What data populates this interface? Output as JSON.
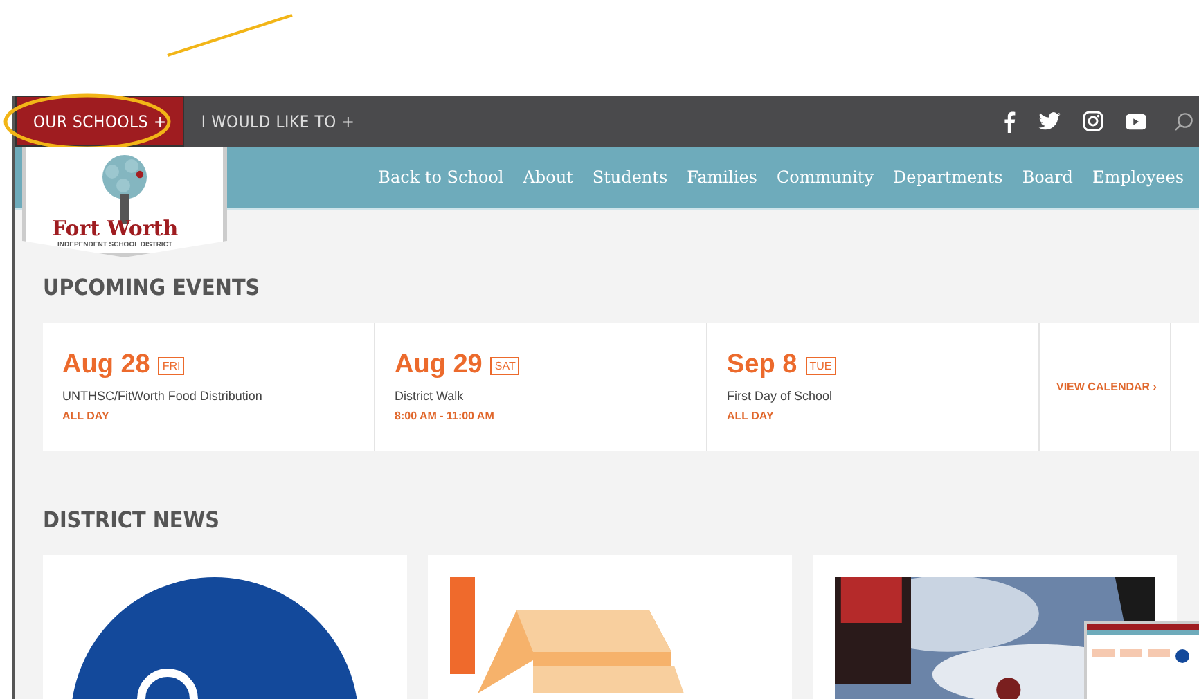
{
  "utility_bar": {
    "menus": [
      {
        "label": "OUR SCHOOLS",
        "icon": "+",
        "selected": true
      },
      {
        "label": "I WOULD LIKE TO",
        "icon": "+",
        "selected": false
      }
    ],
    "social": [
      {
        "kind": "facebook"
      },
      {
        "kind": "twitter"
      },
      {
        "kind": "instagram"
      },
      {
        "kind": "youtube"
      }
    ]
  },
  "logo": {
    "name": "Fort Worth",
    "subtitle": "INDEPENDENT SCHOOL DISTRICT"
  },
  "nav": [
    "Back to School",
    "About",
    "Students",
    "Families",
    "Community",
    "Departments",
    "Board",
    "Employees"
  ],
  "events": {
    "title": "UPCOMING EVENTS",
    "items": [
      {
        "date": "Aug 28",
        "day": "FRI",
        "name": "UNTHSC/FitWorth Food Distribution",
        "time": "ALL DAY"
      },
      {
        "date": "Aug 29",
        "day": "SAT",
        "name": "District Walk",
        "time": "8:00 AM - 11:00 AM"
      },
      {
        "date": "Sep 8",
        "day": "TUE",
        "name": "First Day of School",
        "time": "ALL DAY"
      }
    ],
    "link": {
      "label": "VIEW CALENDAR",
      "icon": "›"
    }
  },
  "news": {
    "title": "DISTRICT NEWS",
    "cards": [
      {
        "kind": "badge"
      },
      {
        "kind": "blocks"
      },
      {
        "kind": "picture"
      }
    ]
  }
}
